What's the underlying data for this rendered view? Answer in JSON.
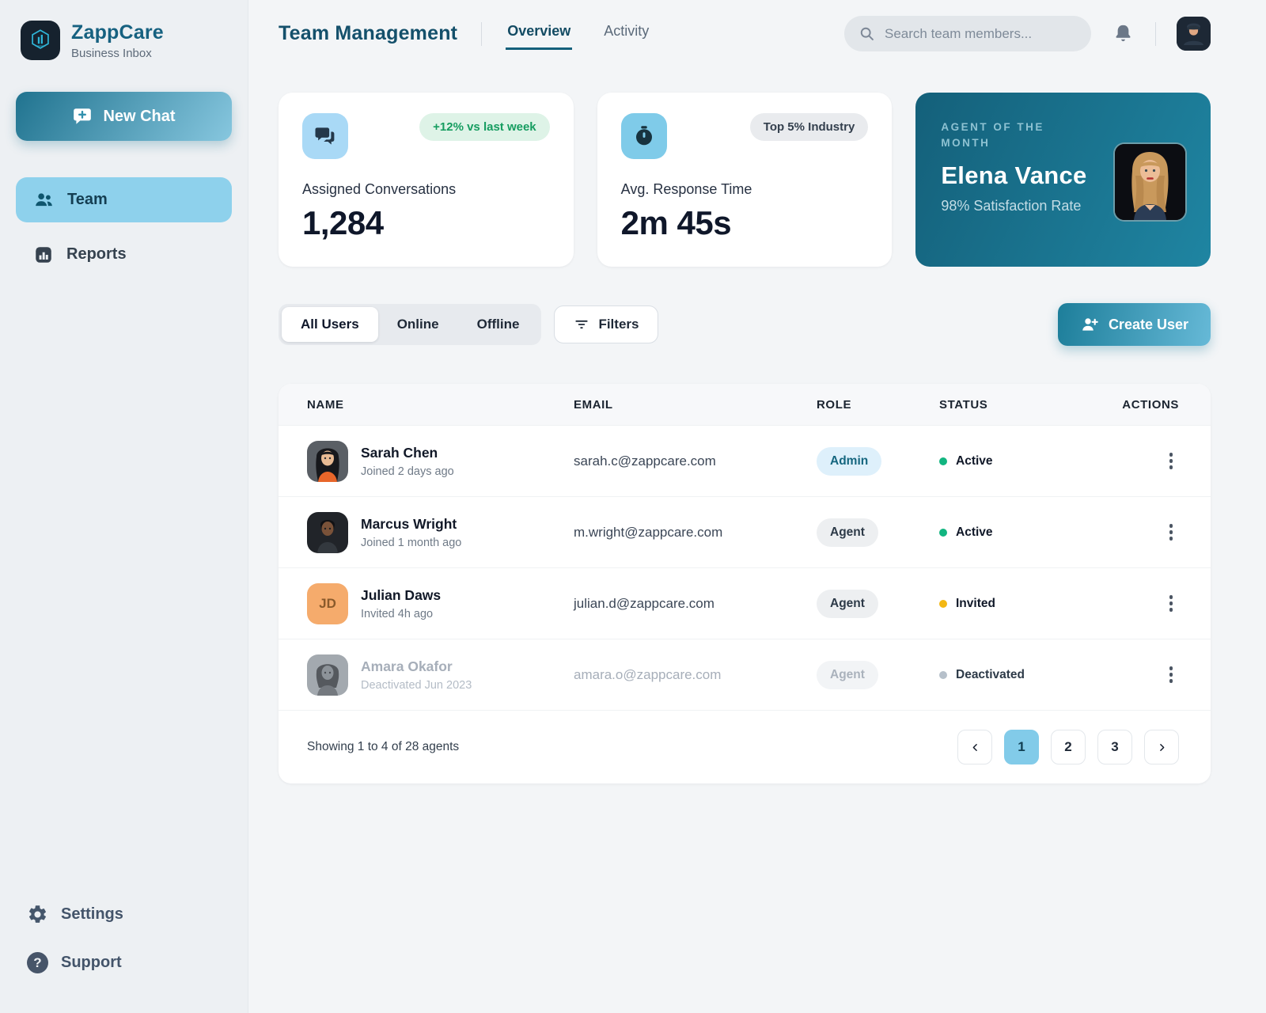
{
  "brand": {
    "name": "ZappCare",
    "subtitle": "Business Inbox"
  },
  "sidebar": {
    "new_chat_label": "New Chat",
    "items": [
      {
        "label": "Team"
      },
      {
        "label": "Reports"
      }
    ],
    "footer_items": [
      {
        "label": "Settings"
      },
      {
        "label": "Support"
      }
    ]
  },
  "header": {
    "title": "Team Management",
    "tabs": [
      {
        "label": "Overview"
      },
      {
        "label": "Activity"
      }
    ],
    "search_placeholder": "Search team members..."
  },
  "stats": {
    "conversations": {
      "badge": "+12% vs last week",
      "label": "Assigned Conversations",
      "value": "1,284"
    },
    "response_time": {
      "badge": "Top 5% Industry",
      "label": "Avg. Response Time",
      "value": "2m 45s"
    },
    "agent_of_month": {
      "eyebrow": "AGENT OF THE MONTH",
      "name": "Elena Vance",
      "detail": "98% Satisfaction Rate"
    }
  },
  "filters": {
    "segments": [
      "All Users",
      "Online",
      "Offline"
    ],
    "filters_label": "Filters",
    "create_user_label": "Create User"
  },
  "table": {
    "columns": [
      "NAME",
      "EMAIL",
      "ROLE",
      "STATUS",
      "ACTIONS"
    ],
    "rows": [
      {
        "name": "Sarah Chen",
        "meta": "Joined 2 days ago",
        "email": "sarah.c@zappcare.com",
        "role": "Admin",
        "status": "Active"
      },
      {
        "name": "Marcus Wright",
        "meta": "Joined 1 month ago",
        "email": "m.wright@zappcare.com",
        "role": "Agent",
        "status": "Active"
      },
      {
        "name": "Julian Daws",
        "meta": "Invited 4h ago",
        "email": "julian.d@zappcare.com",
        "role": "Agent",
        "status": "Invited",
        "initials": "JD"
      },
      {
        "name": "Amara Okafor",
        "meta": "Deactivated Jun 2023",
        "email": "amara.o@zappcare.com",
        "role": "Agent",
        "status": "Deactivated"
      }
    ],
    "footer": {
      "summary": "Showing 1 to 4 of 28 agents",
      "pages": [
        "1",
        "2",
        "3"
      ],
      "active_page": "1"
    }
  },
  "colors": {
    "accent_teal": "#17687f",
    "sidebar_active_bg": "#8ed1ec",
    "button_gradient_start": "#20738f",
    "button_gradient_end": "#87c7df",
    "active_green": "#12b580",
    "invited_amber": "#f3b713",
    "deactivated_gray": "#b6c0ca",
    "green_badge_bg": "#def3e7",
    "green_badge_text": "#169d60",
    "admin_badge_bg": "#def0fb",
    "admin_badge_text": "#15667f"
  }
}
